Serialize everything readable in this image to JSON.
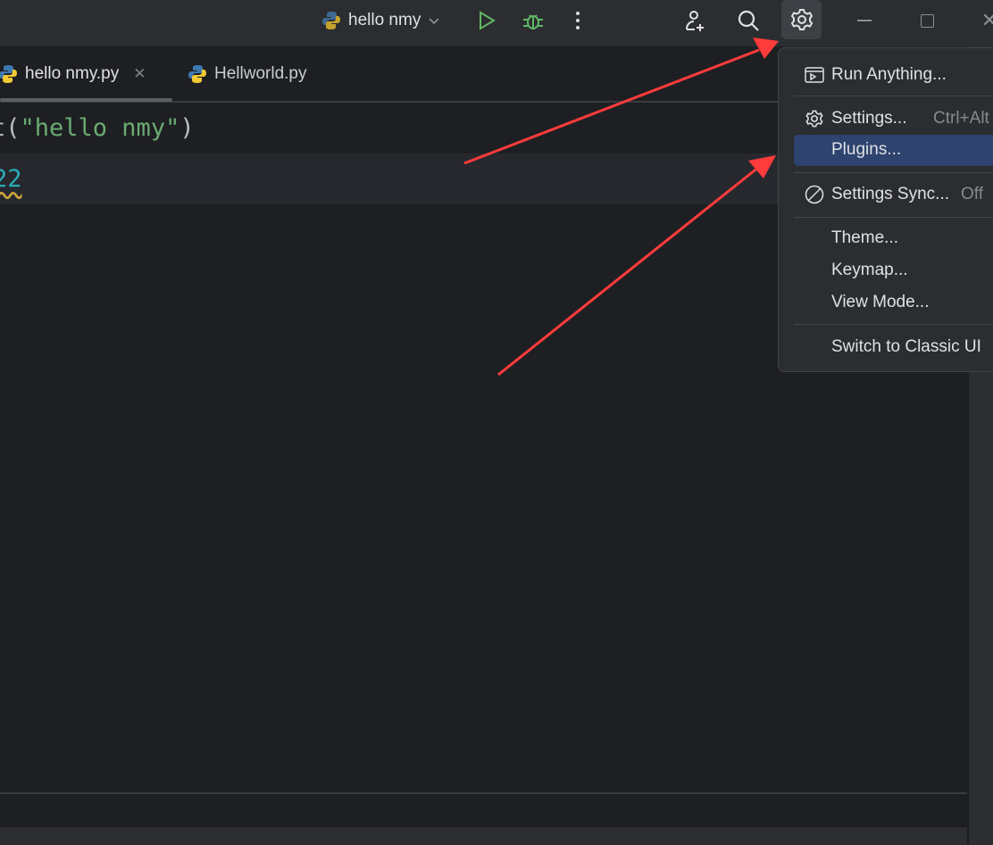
{
  "titlebar": {
    "run_config": "hello nmy"
  },
  "tabs": [
    {
      "label": "hello nmy.py",
      "active": true
    },
    {
      "label": "Hellworld.py",
      "active": false
    }
  ],
  "editor": {
    "lines": [
      {
        "prefix": "t(",
        "string": "\"hello nmy\"",
        "suffix": ")"
      },
      {
        "number": "22"
      }
    ]
  },
  "menu": {
    "items": [
      {
        "label": "Run Anything..."
      },
      {
        "label": "Settings...",
        "shortcut": "Ctrl+Alt"
      },
      {
        "label": "Plugins...",
        "highlighted": true
      },
      {
        "label": "Settings Sync...",
        "status": "Off"
      },
      {
        "label": "Theme..."
      },
      {
        "label": "Keymap..."
      },
      {
        "label": "View Mode..."
      },
      {
        "label": "Switch to Classic UI"
      }
    ]
  },
  "colors": {
    "accent": "#2e436e",
    "string": "#6aab73",
    "number": "#2aacb8",
    "annotation_arrow": "#ff3b3b",
    "run": "#5fb865"
  }
}
